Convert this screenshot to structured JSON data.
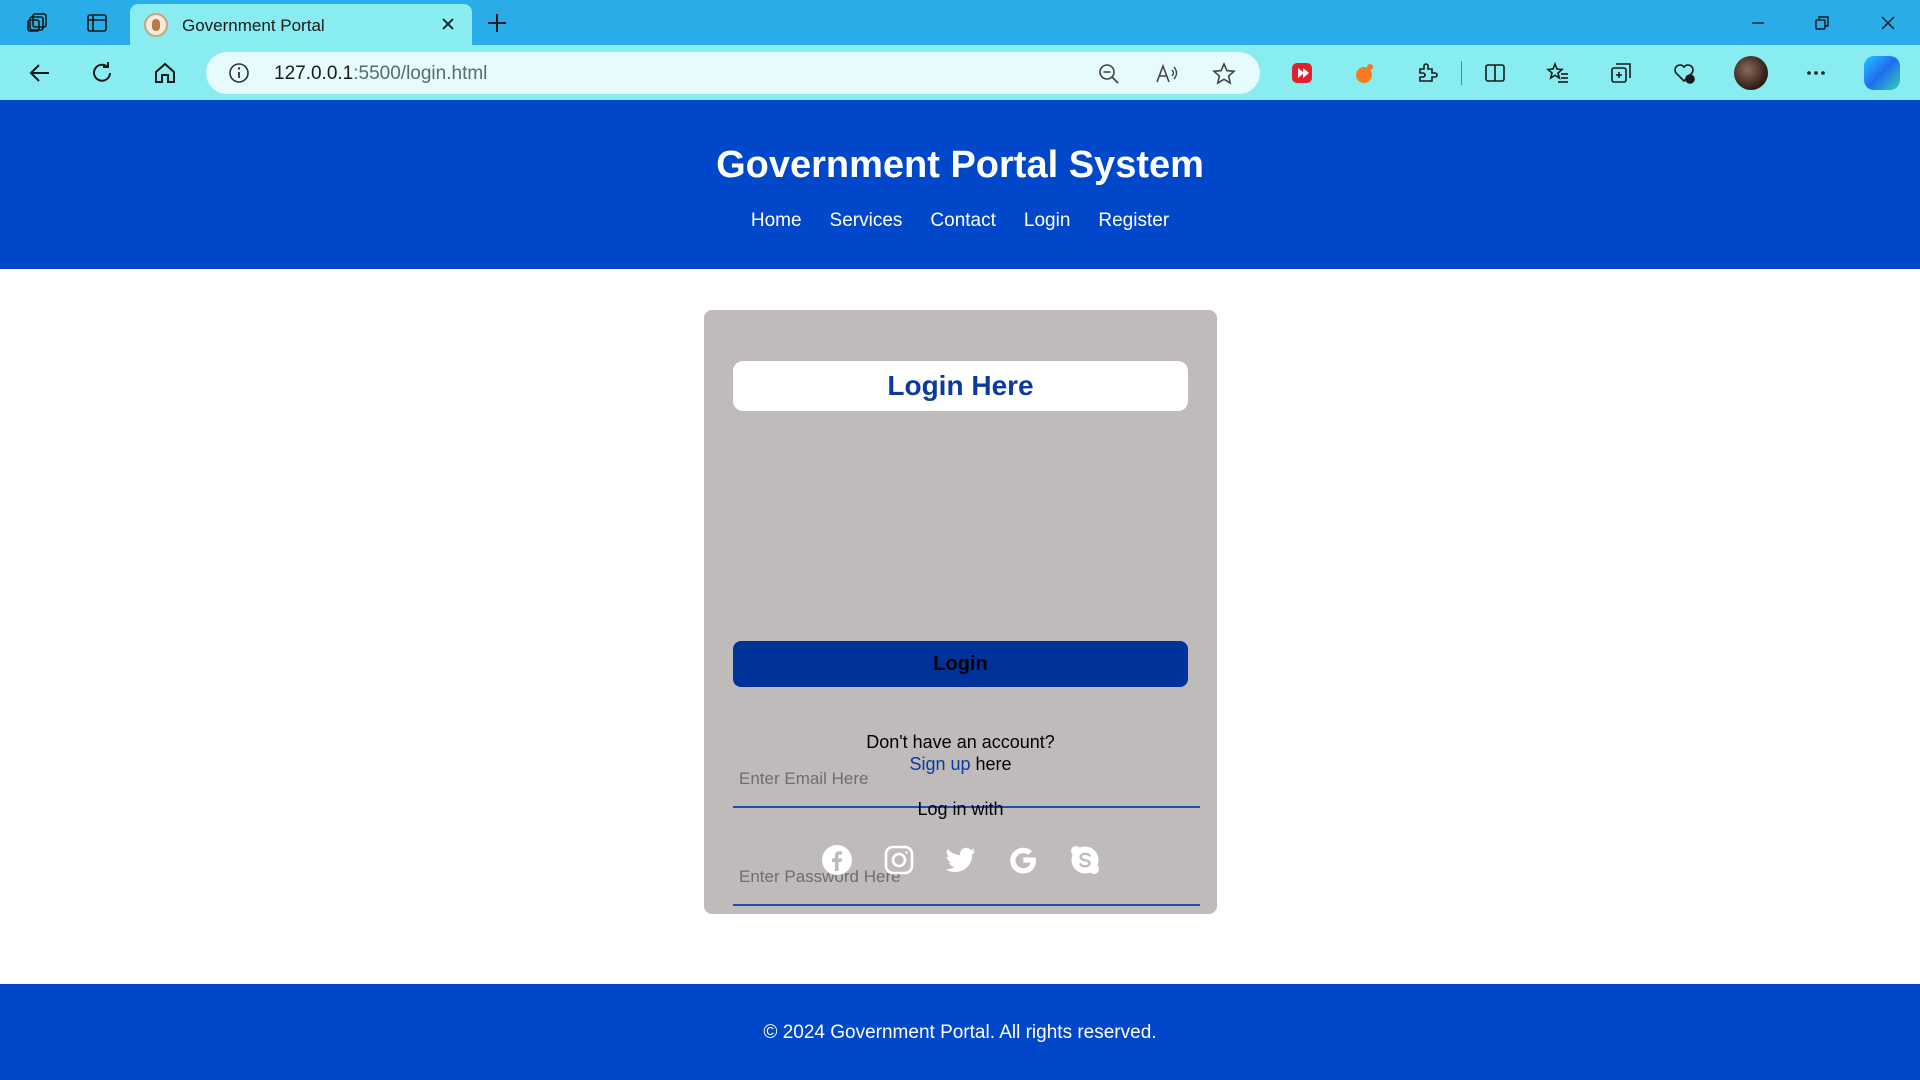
{
  "browser": {
    "tab_title": "Government Portal",
    "url_host": "127.0.0.1",
    "url_rest": ":5500/login.html"
  },
  "header": {
    "title": "Government Portal System",
    "nav": [
      "Home",
      "Services",
      "Contact",
      "Login",
      "Register"
    ]
  },
  "login_card": {
    "heading": "Login Here",
    "email_placeholder": "Enter Email Here",
    "password_placeholder": "Enter Password Here",
    "submit_label": "Login",
    "no_account_text": "Don't have an account?",
    "signup_link": "Sign up",
    "signup_suffix": "here",
    "login_with_text": "Log in with",
    "socials": [
      "facebook-icon",
      "instagram-icon",
      "twitter-icon",
      "google-icon",
      "skype-icon"
    ]
  },
  "footer": {
    "text": "© 2024 Government Portal. All rights reserved."
  },
  "colors": {
    "header_bg": "#0047c9",
    "card_bg": "#bfbbbb",
    "button_bg": "#00339a",
    "heading_color": "#0c3a9e"
  }
}
